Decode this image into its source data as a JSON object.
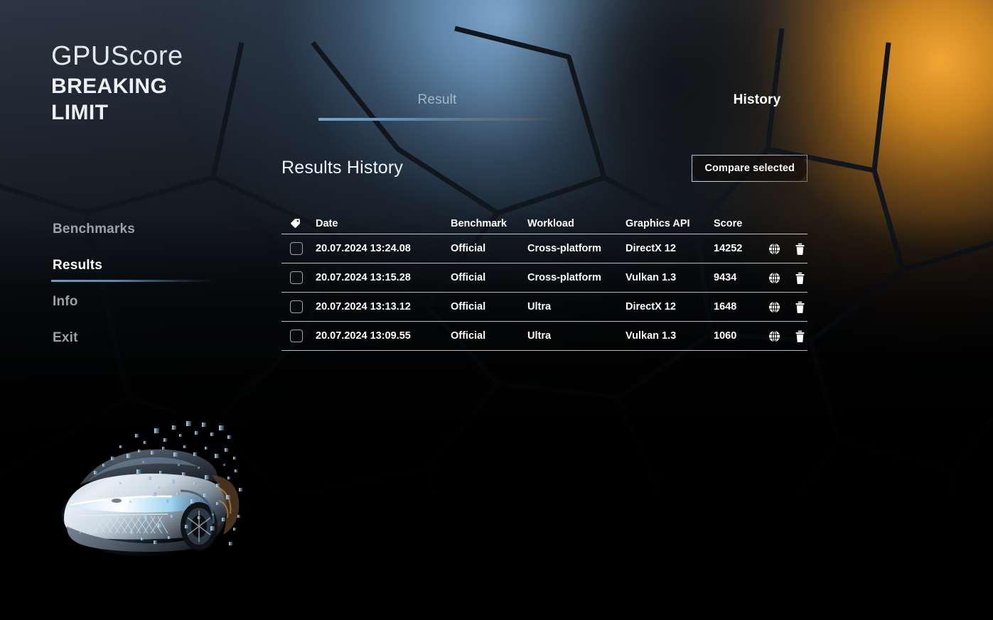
{
  "app": {
    "logo_line1_bold": "GPU",
    "logo_line1_light": "Score",
    "logo_line2": "BREAKING",
    "logo_line3": "LIMIT",
    "accent_blue": "#6d9cc4",
    "accent_orange": "#f0a033",
    "background_left": "#2c3542",
    "background_black": "#000000"
  },
  "sidebar": {
    "items": [
      {
        "label": "Benchmarks",
        "active": false
      },
      {
        "label": "Results",
        "active": true
      },
      {
        "label": "Info",
        "active": false
      },
      {
        "label": "Exit",
        "active": false
      }
    ]
  },
  "tabs": [
    {
      "label": "Result",
      "active": false
    },
    {
      "label": "History",
      "active": true
    }
  ],
  "panel": {
    "title": "Results History",
    "compare_button_label": "Compare selected",
    "tag_icon": "tag-icon"
  },
  "table": {
    "columns": [
      {
        "key": "tag",
        "label": ""
      },
      {
        "key": "date",
        "label": "Date"
      },
      {
        "key": "benchmark",
        "label": "Benchmark"
      },
      {
        "key": "workload",
        "label": "Workload"
      },
      {
        "key": "api",
        "label": "Graphics API"
      },
      {
        "key": "score",
        "label": "Score"
      }
    ],
    "row_icons": [
      "globe-icon",
      "trash-icon"
    ],
    "rows": [
      {
        "selected": false,
        "date": "20.07.2024 13:24.08",
        "benchmark": "Official",
        "workload": "Cross-platform",
        "api": "DirectX 12",
        "score": "14252"
      },
      {
        "selected": false,
        "date": "20.07.2024 13:15.28",
        "benchmark": "Official",
        "workload": "Cross-platform",
        "api": "Vulkan 1.3",
        "score": "9434"
      },
      {
        "selected": false,
        "date": "20.07.2024 13:13.12",
        "benchmark": "Official",
        "workload": "Ultra",
        "api": "DirectX 12",
        "score": "1648"
      },
      {
        "selected": false,
        "date": "20.07.2024 13:09.55",
        "benchmark": "Official",
        "workload": "Ultra",
        "api": "Vulkan 1.3",
        "score": "1060"
      }
    ]
  },
  "decor": {
    "car_artwork": "concept-car-dissolve-artwork",
    "cell_pattern": "voronoi-cell-pattern"
  }
}
